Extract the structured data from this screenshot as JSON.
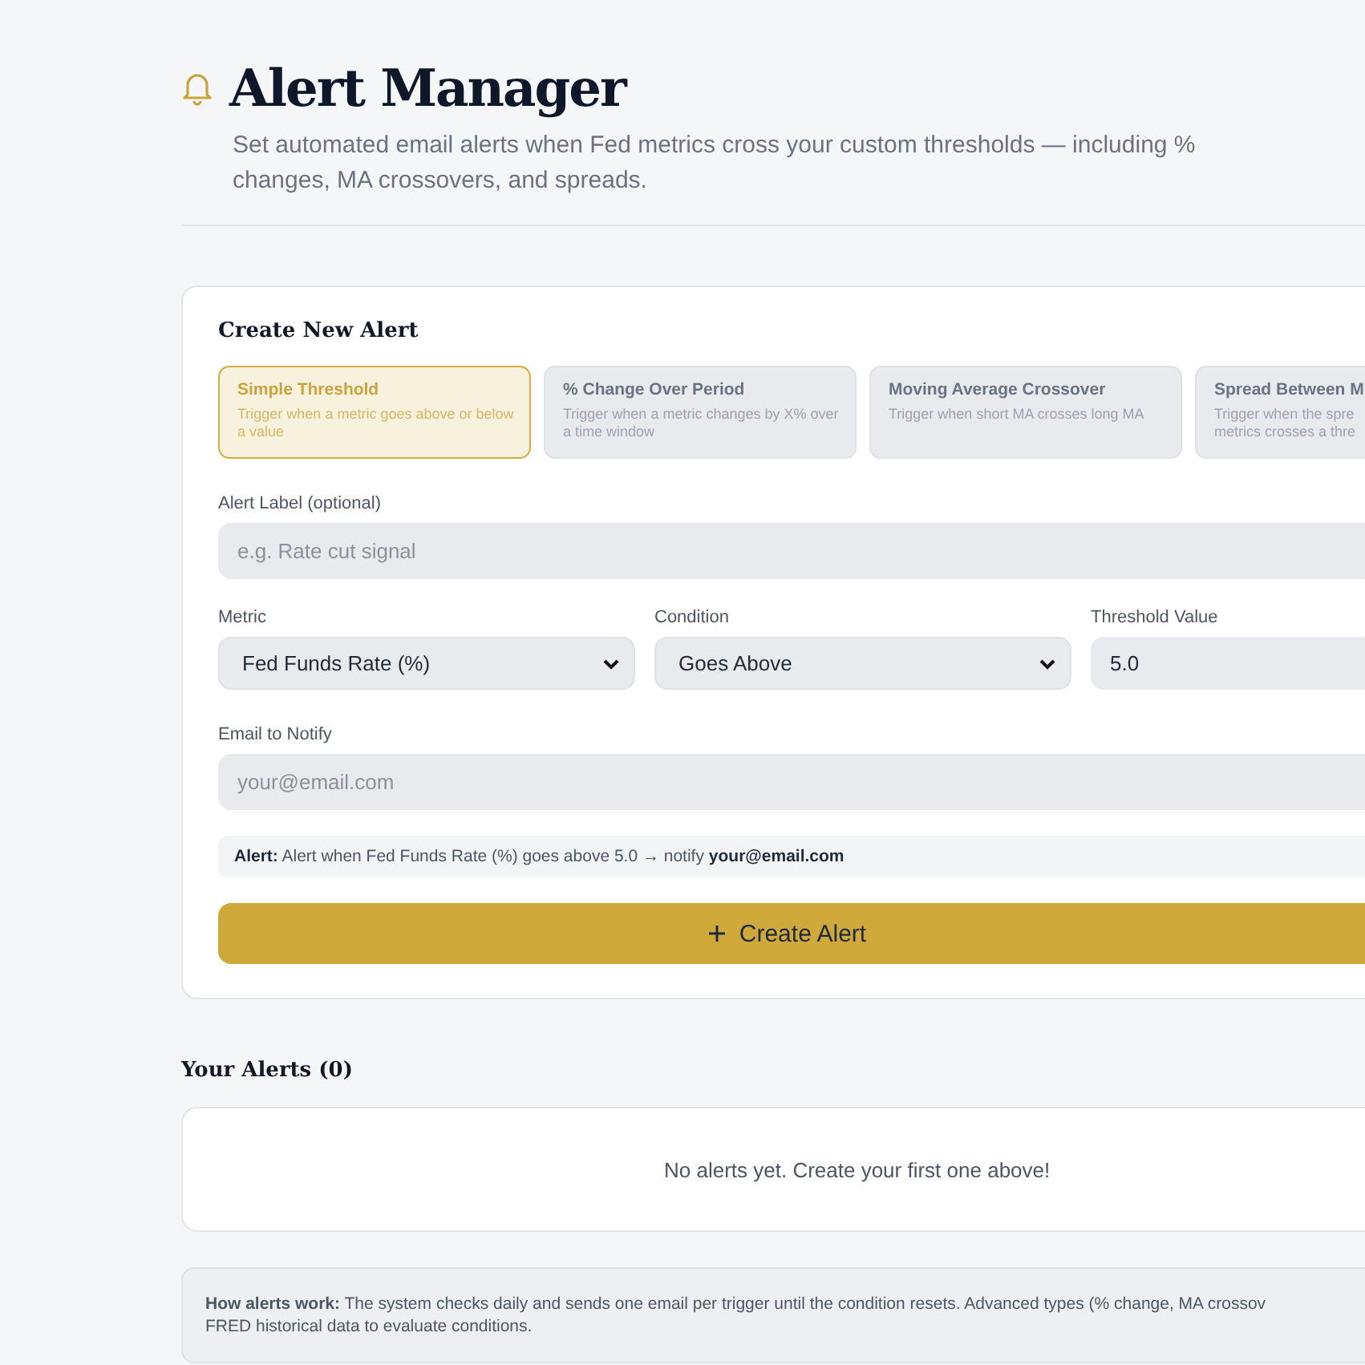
{
  "header": {
    "title": "Alert Manager",
    "subtitle": "Set automated email alerts when Fed metrics cross your custom thresholds — including % changes, MA crossovers, and spreads."
  },
  "create_panel": {
    "title": "Create New Alert",
    "alert_types": [
      {
        "title": "Simple Threshold",
        "description": "Trigger when a metric goes above or below a value",
        "selected": true
      },
      {
        "title": "% Change Over Period",
        "description": "Trigger when a metric changes by X% over a time window",
        "selected": false
      },
      {
        "title": "Moving Average Crossover",
        "description": "Trigger when short MA crosses long MA",
        "selected": false
      },
      {
        "title": "Spread Between M",
        "description": "Trigger when the spre metrics crosses a thre",
        "selected": false
      }
    ],
    "label_field": {
      "label": "Alert Label (optional)",
      "placeholder": "e.g. Rate cut signal"
    },
    "metric": {
      "label": "Metric",
      "value": "Fed Funds Rate (%)"
    },
    "condition": {
      "label": "Condition",
      "value": "Goes Above"
    },
    "threshold": {
      "label": "Threshold Value",
      "value": "5.0"
    },
    "email": {
      "label": "Email to Notify",
      "placeholder": "your@email.com"
    },
    "summary": "**Alert:** Alert when Fed Funds Rate (%) goes above 5.0 → notify **your@email.com**",
    "create_button": {
      "label": "Create Alert"
    }
  },
  "alerts_section": {
    "title": "Your Alerts (0)",
    "empty_message": "No alerts yet. Create your first one above!"
  },
  "info": {
    "lines": [
      "**How alerts work:** The system checks daily and sends one email per trigger until the condition resets. Advanced types (% change, MA crossov",
      "FRED historical data to evaluate conditions."
    ]
  }
}
